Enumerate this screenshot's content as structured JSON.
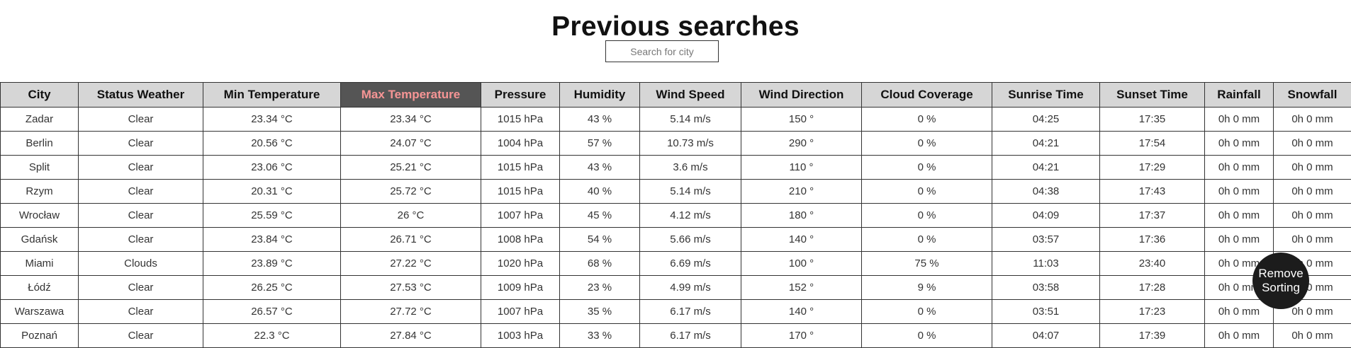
{
  "page": {
    "title": "Previous searches",
    "search_placeholder": "Search for city",
    "remove_sorting_label": "Remove\nSorting",
    "sorted_column": "Max Temperature",
    "colors": {
      "header_bg": "#d6d6d6",
      "sorted_header_bg": "#555555",
      "sorted_header_text": "#f79595",
      "button_bg": "#1c1c1c"
    }
  },
  "table": {
    "columns": [
      {
        "key": "city",
        "label": "City"
      },
      {
        "key": "status",
        "label": "Status Weather"
      },
      {
        "key": "min_temp",
        "label": "Min Temperature"
      },
      {
        "key": "max_temp",
        "label": "Max Temperature"
      },
      {
        "key": "pressure",
        "label": "Pressure"
      },
      {
        "key": "humidity",
        "label": "Humidity"
      },
      {
        "key": "wind_speed",
        "label": "Wind Speed"
      },
      {
        "key": "wind_direction",
        "label": "Wind Direction"
      },
      {
        "key": "cloud",
        "label": "Cloud Coverage"
      },
      {
        "key": "sunrise",
        "label": "Sunrise Time"
      },
      {
        "key": "sunset",
        "label": "Sunset Time"
      },
      {
        "key": "rainfall",
        "label": "Rainfall"
      },
      {
        "key": "snowfall",
        "label": "Snowfall"
      }
    ],
    "rows": [
      {
        "city": "Zadar",
        "status": "Clear",
        "min_temp": "23.34 °C",
        "max_temp": "23.34 °C",
        "pressure": "1015 hPa",
        "humidity": "43 %",
        "wind_speed": "5.14 m/s",
        "wind_direction": "150 °",
        "cloud": "0 %",
        "sunrise": "04:25",
        "sunset": "17:35",
        "rainfall": "0h 0 mm",
        "snowfall": "0h 0 mm"
      },
      {
        "city": "Berlin",
        "status": "Clear",
        "min_temp": "20.56 °C",
        "max_temp": "24.07 °C",
        "pressure": "1004 hPa",
        "humidity": "57 %",
        "wind_speed": "10.73 m/s",
        "wind_direction": "290 °",
        "cloud": "0 %",
        "sunrise": "04:21",
        "sunset": "17:54",
        "rainfall": "0h 0 mm",
        "snowfall": "0h 0 mm"
      },
      {
        "city": "Split",
        "status": "Clear",
        "min_temp": "23.06 °C",
        "max_temp": "25.21 °C",
        "pressure": "1015 hPa",
        "humidity": "43 %",
        "wind_speed": "3.6 m/s",
        "wind_direction": "110 °",
        "cloud": "0 %",
        "sunrise": "04:21",
        "sunset": "17:29",
        "rainfall": "0h 0 mm",
        "snowfall": "0h 0 mm"
      },
      {
        "city": "Rzym",
        "status": "Clear",
        "min_temp": "20.31 °C",
        "max_temp": "25.72 °C",
        "pressure": "1015 hPa",
        "humidity": "40 %",
        "wind_speed": "5.14 m/s",
        "wind_direction": "210 °",
        "cloud": "0 %",
        "sunrise": "04:38",
        "sunset": "17:43",
        "rainfall": "0h 0 mm",
        "snowfall": "0h 0 mm"
      },
      {
        "city": "Wrocław",
        "status": "Clear",
        "min_temp": "25.59 °C",
        "max_temp": "26 °C",
        "pressure": "1007 hPa",
        "humidity": "45 %",
        "wind_speed": "4.12 m/s",
        "wind_direction": "180 °",
        "cloud": "0 %",
        "sunrise": "04:09",
        "sunset": "17:37",
        "rainfall": "0h 0 mm",
        "snowfall": "0h 0 mm"
      },
      {
        "city": "Gdańsk",
        "status": "Clear",
        "min_temp": "23.84 °C",
        "max_temp": "26.71 °C",
        "pressure": "1008 hPa",
        "humidity": "54 %",
        "wind_speed": "5.66 m/s",
        "wind_direction": "140 °",
        "cloud": "0 %",
        "sunrise": "03:57",
        "sunset": "17:36",
        "rainfall": "0h 0 mm",
        "snowfall": "0h 0 mm"
      },
      {
        "city": "Miami",
        "status": "Clouds",
        "min_temp": "23.89 °C",
        "max_temp": "27.22 °C",
        "pressure": "1020 hPa",
        "humidity": "68 %",
        "wind_speed": "6.69 m/s",
        "wind_direction": "100 °",
        "cloud": "75 %",
        "sunrise": "11:03",
        "sunset": "23:40",
        "rainfall": "0h 0 mm",
        "snowfall": "0h 0 mm"
      },
      {
        "city": "Łódź",
        "status": "Clear",
        "min_temp": "26.25 °C",
        "max_temp": "27.53 °C",
        "pressure": "1009 hPa",
        "humidity": "23 %",
        "wind_speed": "4.99 m/s",
        "wind_direction": "152 °",
        "cloud": "9 %",
        "sunrise": "03:58",
        "sunset": "17:28",
        "rainfall": "0h 0 mm",
        "snowfall": "0h 0 mm"
      },
      {
        "city": "Warszawa",
        "status": "Clear",
        "min_temp": "26.57 °C",
        "max_temp": "27.72 °C",
        "pressure": "1007 hPa",
        "humidity": "35 %",
        "wind_speed": "6.17 m/s",
        "wind_direction": "140 °",
        "cloud": "0 %",
        "sunrise": "03:51",
        "sunset": "17:23",
        "rainfall": "0h 0 mm",
        "snowfall": "0h 0 mm"
      },
      {
        "city": "Poznań",
        "status": "Clear",
        "min_temp": "22.3 °C",
        "max_temp": "27.84 °C",
        "pressure": "1003 hPa",
        "humidity": "33 %",
        "wind_speed": "6.17 m/s",
        "wind_direction": "170 °",
        "cloud": "0 %",
        "sunrise": "04:07",
        "sunset": "17:39",
        "rainfall": "0h 0 mm",
        "snowfall": "0h 0 mm"
      }
    ]
  }
}
